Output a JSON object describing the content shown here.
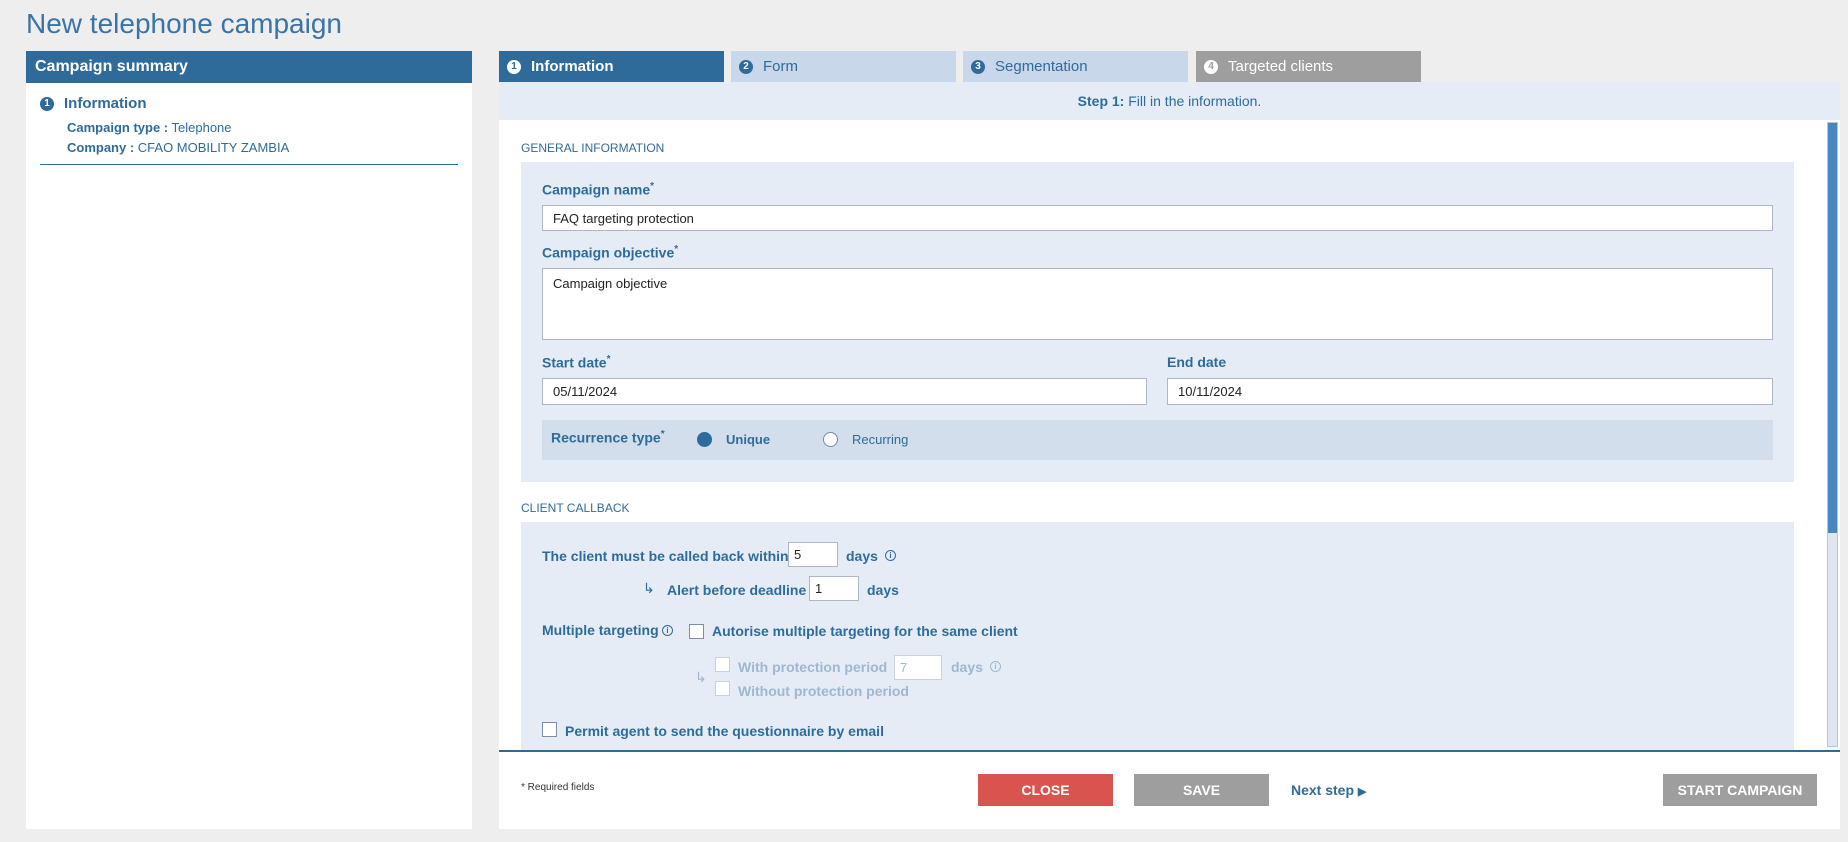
{
  "page_title": "New telephone campaign",
  "summary": {
    "header": "Campaign summary",
    "step_number": "1",
    "step_label": "Information",
    "campaign_type_label": "Campaign type :",
    "campaign_type_value": "Telephone",
    "company_label": "Company :",
    "company_value": "CFAO MOBILITY ZAMBIA"
  },
  "tabs": [
    {
      "number": "1",
      "label": "Information",
      "state": "active"
    },
    {
      "number": "2",
      "label": "Form",
      "state": "inactive"
    },
    {
      "number": "3",
      "label": "Segmentation",
      "state": "inactive"
    },
    {
      "number": "4",
      "label": "Targeted clients",
      "state": "disabled"
    }
  ],
  "step_bar": {
    "bold": "Step 1:",
    "text": " Fill in the information."
  },
  "general": {
    "section_title": "GENERAL INFORMATION",
    "campaign_name_label": "Campaign name",
    "campaign_name_value": "FAQ targeting protection",
    "campaign_objective_label": "Campaign objective",
    "campaign_objective_value": "Campaign objective",
    "start_date_label": "Start date",
    "start_date_value": "05/11/2024",
    "end_date_label": "End date",
    "end_date_value": "10/11/2024",
    "recurrence_label": "Recurrence type",
    "recurrence_options": [
      "Unique",
      "Recurring"
    ],
    "recurrence_selected": "Unique",
    "required_mark": "*"
  },
  "callback": {
    "section_title": "CLIENT CALLBACK",
    "callback_text": "The client must be called back within",
    "callback_days": "5",
    "days": "days",
    "alert_text": "Alert before deadline",
    "alert_days": "1",
    "multiple_label": "Multiple targeting",
    "autorise_text": "Autorise multiple targeting for the same client",
    "with_protection": "With protection period",
    "protection_days": "7",
    "without_protection": "Without protection period",
    "permit_email": "Permit agent to send the questionnaire by email",
    "info_glyph": "i"
  },
  "footer": {
    "required_note": "* Required fields",
    "close": "CLOSE",
    "save": "SAVE",
    "next_step": "Next step",
    "start_campaign": "START CAMPAIGN"
  },
  "colors": {
    "primary": "#2f6b9a",
    "tab_inactive": "#c8d7ea",
    "section_bg": "#e5ecf5",
    "close_button": "#d9534f",
    "grey_button": "#9e9e9e"
  }
}
